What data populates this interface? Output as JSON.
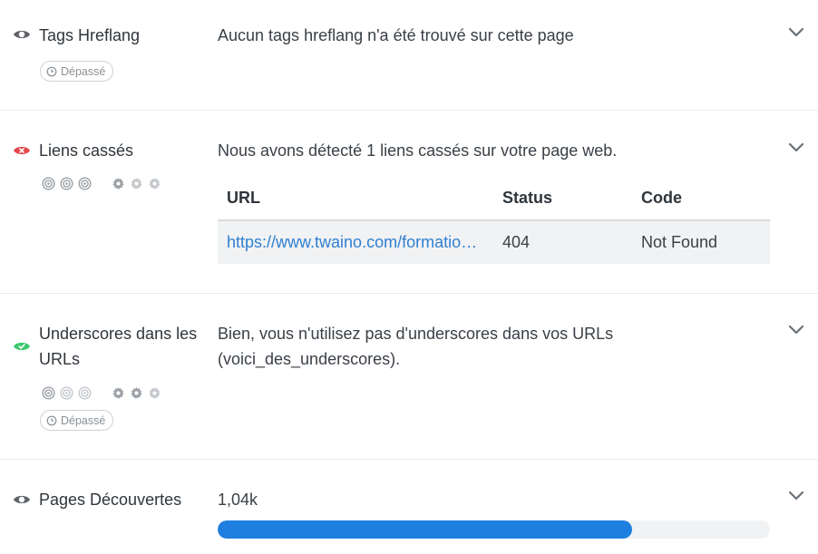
{
  "sections": [
    {
      "title": "Tags Hreflang",
      "status": "neutral",
      "description": "Aucun tags hreflang n'a été trouvé sur cette page",
      "badge": "Dépassé"
    },
    {
      "title": "Liens cassés",
      "status": "error",
      "description": "Nous avons détecté 1 liens cassés sur votre page web.",
      "importance_level": 3,
      "difficulty_level": 3,
      "table": {
        "headers": [
          "URL",
          "Status",
          "Code"
        ],
        "rows": [
          {
            "url": "https://www.twaino.com/formation-seo/",
            "status": "404",
            "code": "Not Found"
          }
        ]
      }
    },
    {
      "title_line1": "Underscores dans les",
      "title_line2": "URLs",
      "status": "success",
      "description_line1": "Bien, vous n'utilisez pas d'underscores dans vos URLs",
      "description_line2": "(voici_des_underscores).",
      "importance_level": 1,
      "difficulty_level": 2,
      "badge": "Dépassé"
    },
    {
      "title": "Pages Découvertes",
      "status": "neutral",
      "value": "1,04k",
      "progress": 0.75
    }
  ],
  "colors": {
    "neutral": "#5f6368",
    "error": "#e5484d",
    "success": "#3cc86e",
    "link": "#2f7fd1",
    "progress": "#1e7fe0"
  }
}
